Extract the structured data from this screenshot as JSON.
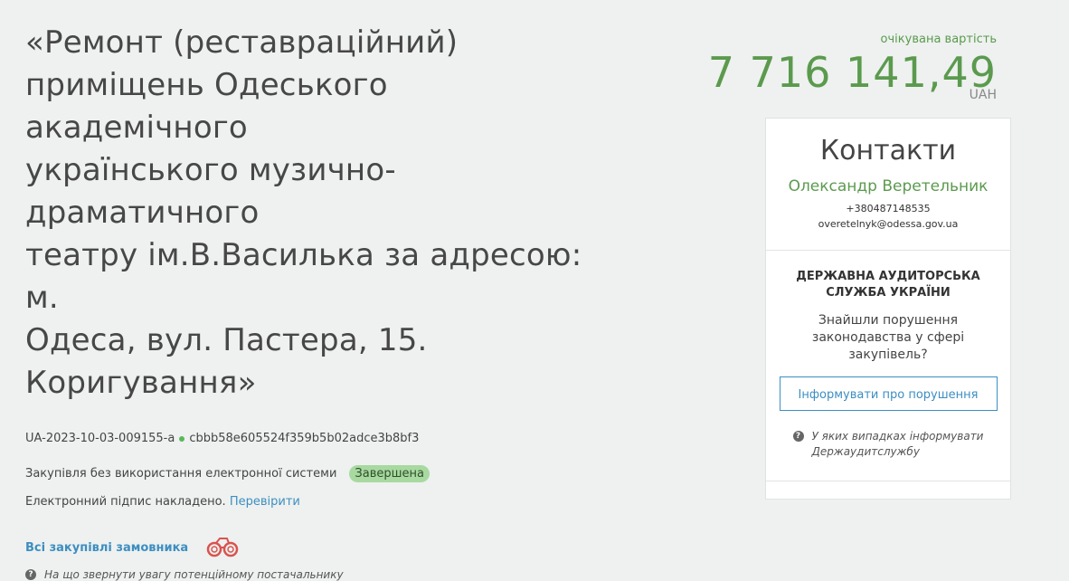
{
  "tender": {
    "title_lines": [
      "«Ремонт (реставраційний)",
      "приміщень Одеського академічного",
      "українського музично-драматичного",
      "театру ім.В.Василька за адресою: м.",
      "Одеса, вул. Пастера, 15.",
      "Коригування»"
    ],
    "id": "UA-2023-10-03-009155-a",
    "hash": "cbbb58e605524f359b5b02adce3b8bf3",
    "procurement_type": "Закупівля без використання електронної системи",
    "status": "Завершена",
    "signature_text": "Електронний підпис накладено.",
    "signature_link": "Перевірити",
    "all_purchases_link": "Всі закупівлі замовника",
    "hint": "На що звернути увагу потенційному постачальнику"
  },
  "price": {
    "caption": "очікувана вартість",
    "value": "7 716 141,49",
    "currency": "UAH"
  },
  "contacts": {
    "heading": "Контакти",
    "name": "Олександр Веретельник",
    "phone": "+380487148535",
    "email": "overetelnyk@odessa.gov.ua"
  },
  "audit": {
    "title_line1": "ДЕРЖАВНА АУДИТОРСЬКА",
    "title_line2": "СЛУЖБА УКРАЇНИ",
    "question_line1": "Знайшли порушення",
    "question_line2": "законодавства у сфері закупівель?",
    "button": "Інформувати про порушення",
    "hint_line1": "У яких випадках інформувати",
    "hint_line2": "Держаудитслужбу"
  },
  "colors": {
    "accent_green": "#5b9a4e",
    "link_blue": "#3d8ec1",
    "badge_green": "#a8d9a0",
    "binoculars_red": "#d9534f"
  },
  "icons": {
    "question": "question-circle-icon",
    "binoculars": "binoculars-icon"
  }
}
